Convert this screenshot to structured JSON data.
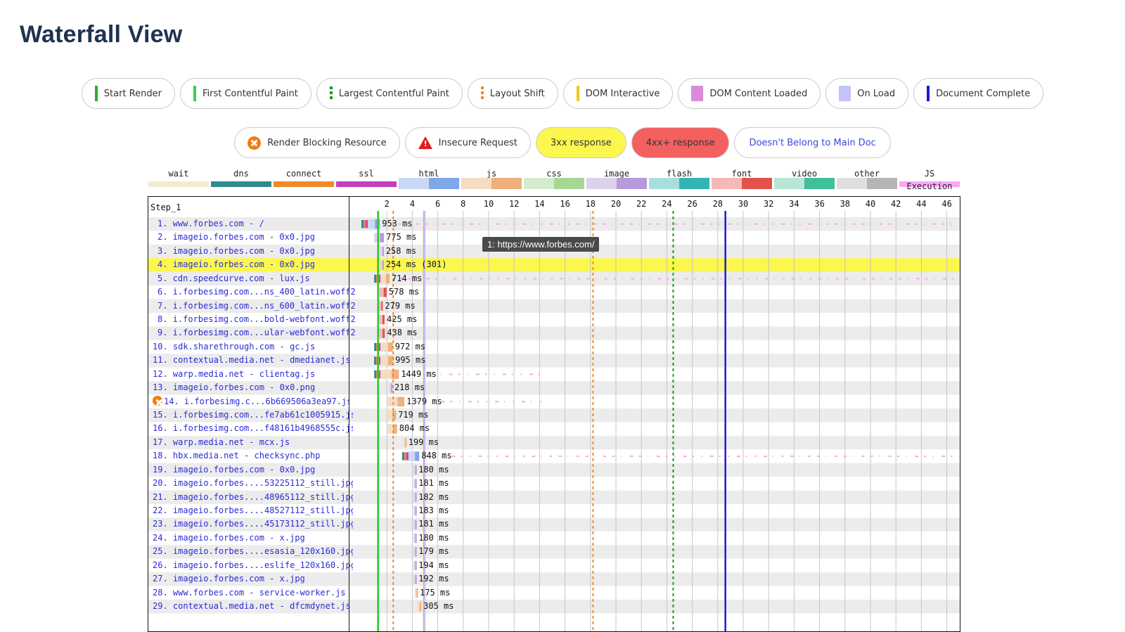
{
  "title": "Waterfall View",
  "legend_marks": [
    {
      "label": "Start Render",
      "color": "#22b422",
      "style": "line"
    },
    {
      "label": "First Contentful Paint",
      "color": "#3fcf3f",
      "style": "line"
    },
    {
      "label": "Largest Contentful Paint",
      "color": "#1a9a1a",
      "style": "dash"
    },
    {
      "label": "Layout Shift",
      "color": "#f08a28",
      "style": "dash"
    },
    {
      "label": "DOM Interactive",
      "color": "#f5c518",
      "style": "line"
    },
    {
      "label": "DOM Content Loaded",
      "color": "#d98bd8",
      "style": "box"
    },
    {
      "label": "On Load",
      "color": "#c3c3fa",
      "style": "box"
    },
    {
      "label": "Document Complete",
      "color": "#1b1bd6",
      "style": "line"
    }
  ],
  "legend_flags": [
    {
      "label": "Render Blocking Resource",
      "icon": "render-blocking-icon"
    },
    {
      "label": "Insecure Request",
      "icon": "warning-icon"
    },
    {
      "label": "3xx response",
      "variant": "yellow"
    },
    {
      "label": "4xx+ response",
      "variant": "red"
    },
    {
      "label": "Doesn't Belong to Main Doc",
      "variant": "blue-text"
    }
  ],
  "type_legend": [
    {
      "label": "wait",
      "colors": [
        "#f1ecd0"
      ]
    },
    {
      "label": "dns",
      "colors": [
        "#2e8b8f"
      ]
    },
    {
      "label": "connect",
      "colors": [
        "#f0892c"
      ]
    },
    {
      "label": "ssl",
      "colors": [
        "#c43fbf"
      ]
    },
    {
      "label": "html",
      "colors": [
        "#c8d8f5",
        "#7fa7e8"
      ]
    },
    {
      "label": "js",
      "colors": [
        "#f6dcc4",
        "#efb07a"
      ]
    },
    {
      "label": "css",
      "colors": [
        "#d4eccd",
        "#a6d796"
      ]
    },
    {
      "label": "image",
      "colors": [
        "#ddd1ee",
        "#b79ad9"
      ]
    },
    {
      "label": "flash",
      "colors": [
        "#a9dede",
        "#34b4b4"
      ]
    },
    {
      "label": "font",
      "colors": [
        "#f4b9b6",
        "#e2534c"
      ]
    },
    {
      "label": "video",
      "colors": [
        "#b8e6d6",
        "#3fbf9a"
      ]
    },
    {
      "label": "other",
      "colors": [
        "#dedede",
        "#b5b5b5"
      ]
    },
    {
      "label": "JS Execution",
      "colors": [
        "#fda6f4"
      ]
    }
  ],
  "waterfall": {
    "step": "Step_1",
    "ticks": [
      "2",
      "4",
      "6",
      "8",
      "10",
      "12",
      "14",
      "16",
      "18",
      "20",
      "22",
      "24",
      "26",
      "28",
      "30",
      "32",
      "34",
      "36",
      "38",
      "40",
      "42",
      "44",
      "46"
    ],
    "tooltip": "1: https://www.forbes.com/",
    "rows": [
      {
        "label": "1. www.forbes.com - /",
        "ms": "953 ms",
        "type": "html",
        "start": 0.0,
        "highlight": false,
        "blocking": false
      },
      {
        "label": "2. imageio.forbes.com - 0x0.jpg",
        "ms": "775 ms",
        "type": "image",
        "start": 1.0,
        "highlight": false,
        "blocking": false
      },
      {
        "label": "3. imageio.forbes.com - 0x0.jpg",
        "ms": "258 ms",
        "type": "image",
        "start": 1.5,
        "highlight": false,
        "blocking": false
      },
      {
        "label": "4. imageio.forbes.com - 0x0.jpg",
        "ms": "254 ms (301)",
        "type": "image",
        "start": 1.5,
        "highlight": true,
        "blocking": false
      },
      {
        "label": "5. cdn.speedcurve.com - lux.js",
        "ms": "714 ms",
        "type": "js",
        "start": 1.0,
        "highlight": false,
        "blocking": false
      },
      {
        "label": "6. i.forbesimg.com...ns_400_latin.woff2",
        "ms": "578 ms",
        "type": "font",
        "start": 1.4,
        "highlight": false,
        "blocking": false
      },
      {
        "label": "7. i.forbesimg.com...ns_600_latin.woff2",
        "ms": "279 ms",
        "type": "font",
        "start": 1.4,
        "highlight": false,
        "blocking": false
      },
      {
        "label": "8. i.forbesimg.com...bold-webfont.woff2",
        "ms": "425 ms",
        "type": "font",
        "start": 1.4,
        "highlight": false,
        "blocking": false
      },
      {
        "label": "9. i.forbesimg.com...ular-webfont.woff2",
        "ms": "438 ms",
        "type": "font",
        "start": 1.4,
        "highlight": false,
        "blocking": false
      },
      {
        "label": "10. sdk.sharethrough.com - gc.js",
        "ms": "972 ms",
        "type": "js",
        "start": 1.0,
        "highlight": false,
        "blocking": false
      },
      {
        "label": "11. contextual.media.net - dmedianet.js",
        "ms": "995 ms",
        "type": "js",
        "start": 1.0,
        "highlight": false,
        "blocking": false
      },
      {
        "label": "12. warp.media.net - clientag.js",
        "ms": "1449 ms",
        "type": "js",
        "start": 1.0,
        "highlight": false,
        "blocking": false
      },
      {
        "label": "13. imageio.forbes.com - 0x0.png",
        "ms": "218 ms",
        "type": "image",
        "start": 2.2,
        "highlight": false,
        "blocking": false
      },
      {
        "label": "14. i.forbesimg.c...6b669506a3ea97.js",
        "ms": "1379 ms",
        "type": "js",
        "start": 2.0,
        "highlight": false,
        "blocking": true
      },
      {
        "label": "15. i.forbesimg.com...fe7ab61c1005915.js",
        "ms": "719 ms",
        "type": "js",
        "start": 2.0,
        "highlight": false,
        "blocking": false
      },
      {
        "label": "16. i.forbesimg.com...f48161b4968555c.js",
        "ms": "804 ms",
        "type": "js",
        "start": 2.0,
        "highlight": false,
        "blocking": false
      },
      {
        "label": "17. warp.media.net - mcx.js",
        "ms": "199 ms",
        "type": "js",
        "start": 3.3,
        "highlight": false,
        "blocking": false
      },
      {
        "label": "18. hbx.media.net - checksync.php",
        "ms": "848 ms",
        "type": "html",
        "start": 3.2,
        "highlight": false,
        "blocking": false
      },
      {
        "label": "19. imageio.forbes.com - 0x0.jpg",
        "ms": "180 ms",
        "type": "image",
        "start": 4.1,
        "highlight": false,
        "blocking": false
      },
      {
        "label": "20. imageio.forbes....53225112_still.jpg",
        "ms": "181 ms",
        "type": "image",
        "start": 4.1,
        "highlight": false,
        "blocking": false
      },
      {
        "label": "21. imageio.forbes....48965112_still.jpg",
        "ms": "182 ms",
        "type": "image",
        "start": 4.1,
        "highlight": false,
        "blocking": false
      },
      {
        "label": "22. imageio.forbes....48527112_still.jpg",
        "ms": "183 ms",
        "type": "image",
        "start": 4.1,
        "highlight": false,
        "blocking": false
      },
      {
        "label": "23. imageio.forbes....45173112_still.jpg",
        "ms": "181 ms",
        "type": "image",
        "start": 4.1,
        "highlight": false,
        "blocking": false
      },
      {
        "label": "24. imageio.forbes.com - x.jpg",
        "ms": "180 ms",
        "type": "image",
        "start": 4.1,
        "highlight": false,
        "blocking": false
      },
      {
        "label": "25. imageio.forbes....esasia_120x160.jpg",
        "ms": "179 ms",
        "type": "image",
        "start": 4.1,
        "highlight": false,
        "blocking": false
      },
      {
        "label": "26. imageio.forbes....eslife_120x160.jpg",
        "ms": "194 ms",
        "type": "image",
        "start": 4.1,
        "highlight": false,
        "blocking": false
      },
      {
        "label": "27. imageio.forbes.com - x.jpg",
        "ms": "192 ms",
        "type": "image",
        "start": 4.1,
        "highlight": false,
        "blocking": false
      },
      {
        "label": "28. www.forbes.com - service-worker.js",
        "ms": "175 ms",
        "type": "js",
        "start": 4.2,
        "highlight": false,
        "blocking": false
      },
      {
        "label": "29. contextual.media.net - dfcmdynet.js",
        "ms": "305 ms",
        "type": "js",
        "start": 4.4,
        "highlight": false,
        "blocking": false
      }
    ],
    "events": {
      "start_render": 1.3,
      "first_contentful_paint": 1.3,
      "largest_contentful_paint": 24.5,
      "layout_shifts": [
        2.5,
        18.2
      ],
      "dom_interactive": 4.9,
      "dom_content_loaded": 4.95,
      "on_load": 4.98,
      "document_complete": 28.6
    }
  }
}
